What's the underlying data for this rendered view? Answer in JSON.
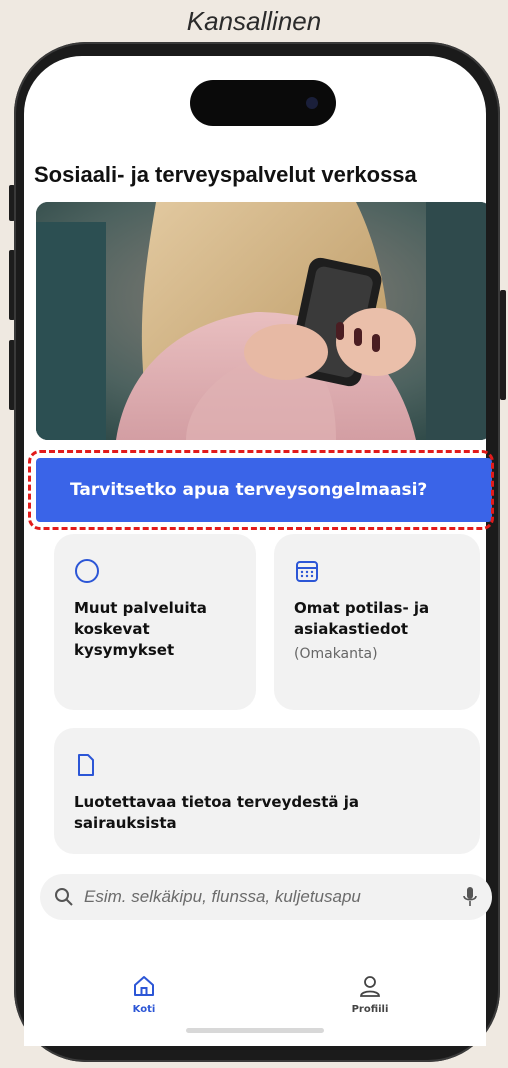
{
  "caption": "Kansallinen",
  "page_title": "Sosiaali- ja terveyspalvelut verkossa",
  "help_banner": {
    "label": "Tarvitsetko apua terveysongelmaasi?"
  },
  "cards": {
    "other_services": {
      "label": "Muut palveluita koskevat kysymykset",
      "icon": "circle-icon"
    },
    "patient_data": {
      "label": "Omat potilas- ja asiakastiedot",
      "sub": "(Omakanta)",
      "icon": "calendar-icon"
    },
    "health_info": {
      "label": "Luotettavaa tietoa terveydestä ja sairauksista",
      "icon": "document-icon"
    }
  },
  "search": {
    "placeholder": "Esim. selkäkipu, flunssa, kuljetusapu"
  },
  "tabs": {
    "home": {
      "label": "Koti",
      "icon": "home-icon",
      "active": true
    },
    "profile": {
      "label": "Profiili",
      "icon": "user-icon"
    }
  },
  "colors": {
    "accent": "#3a64e8",
    "highlight": "#e21b1b",
    "card_bg": "#f2f2f2"
  }
}
